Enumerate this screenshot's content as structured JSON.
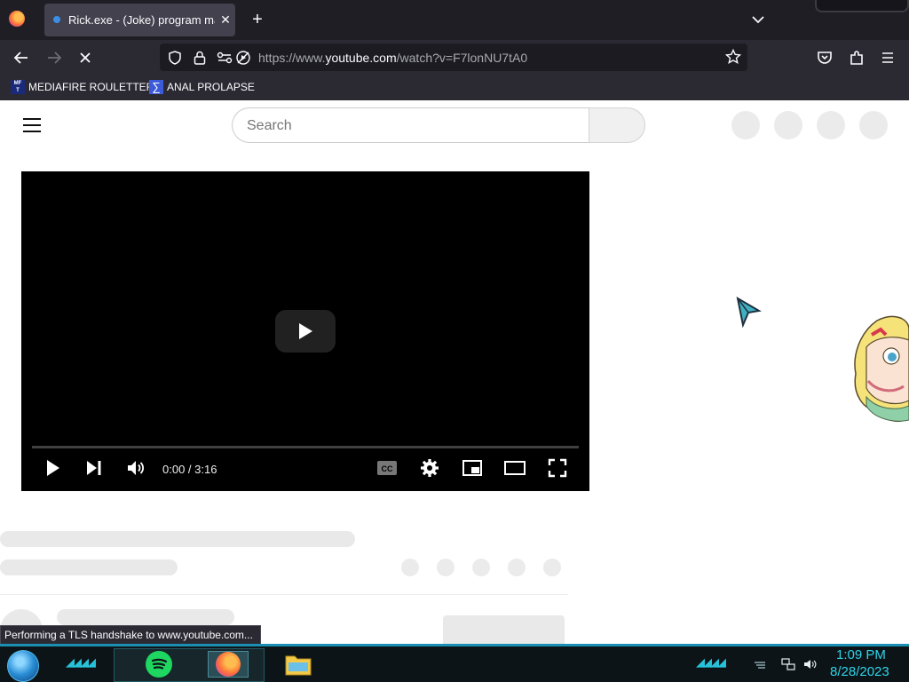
{
  "browser": {
    "tab": {
      "title": "Rick.exe - (Joke) program made",
      "close_glyph": "✕"
    },
    "new_tab_glyph": "+",
    "url": {
      "prefix": "https://www.",
      "host": "youtube.com",
      "path": "/watch?v=F7lonNU7tA0"
    },
    "bookmarks": [
      {
        "label": "MEDIAFIRE ROULETTER",
        "icon": "mediafire-icon",
        "icon_text": "MF\nT"
      },
      {
        "label": "ANAL PROLAPSE",
        "icon": "sigma-icon",
        "icon_text": "∑"
      }
    ],
    "status": "Performing a TLS handshake to www.youtube.com..."
  },
  "youtube": {
    "search": {
      "placeholder": "Search",
      "value": ""
    },
    "player": {
      "time": "0:00 / 3:16",
      "progress_fraction": 0.0,
      "cc_label": "CC"
    }
  },
  "taskbar": {
    "clock": {
      "time": "1:09 PM",
      "date": "8/28/2023"
    },
    "apps": [
      "spotify-icon",
      "firefox-icon",
      "file-explorer-icon"
    ],
    "accent": "#27c2d8"
  },
  "colors": {
    "chrome_dark": "#2b2a33",
    "tab_active": "#42414d",
    "player_bg": "#000000",
    "youtube_red": "#ff0000"
  }
}
